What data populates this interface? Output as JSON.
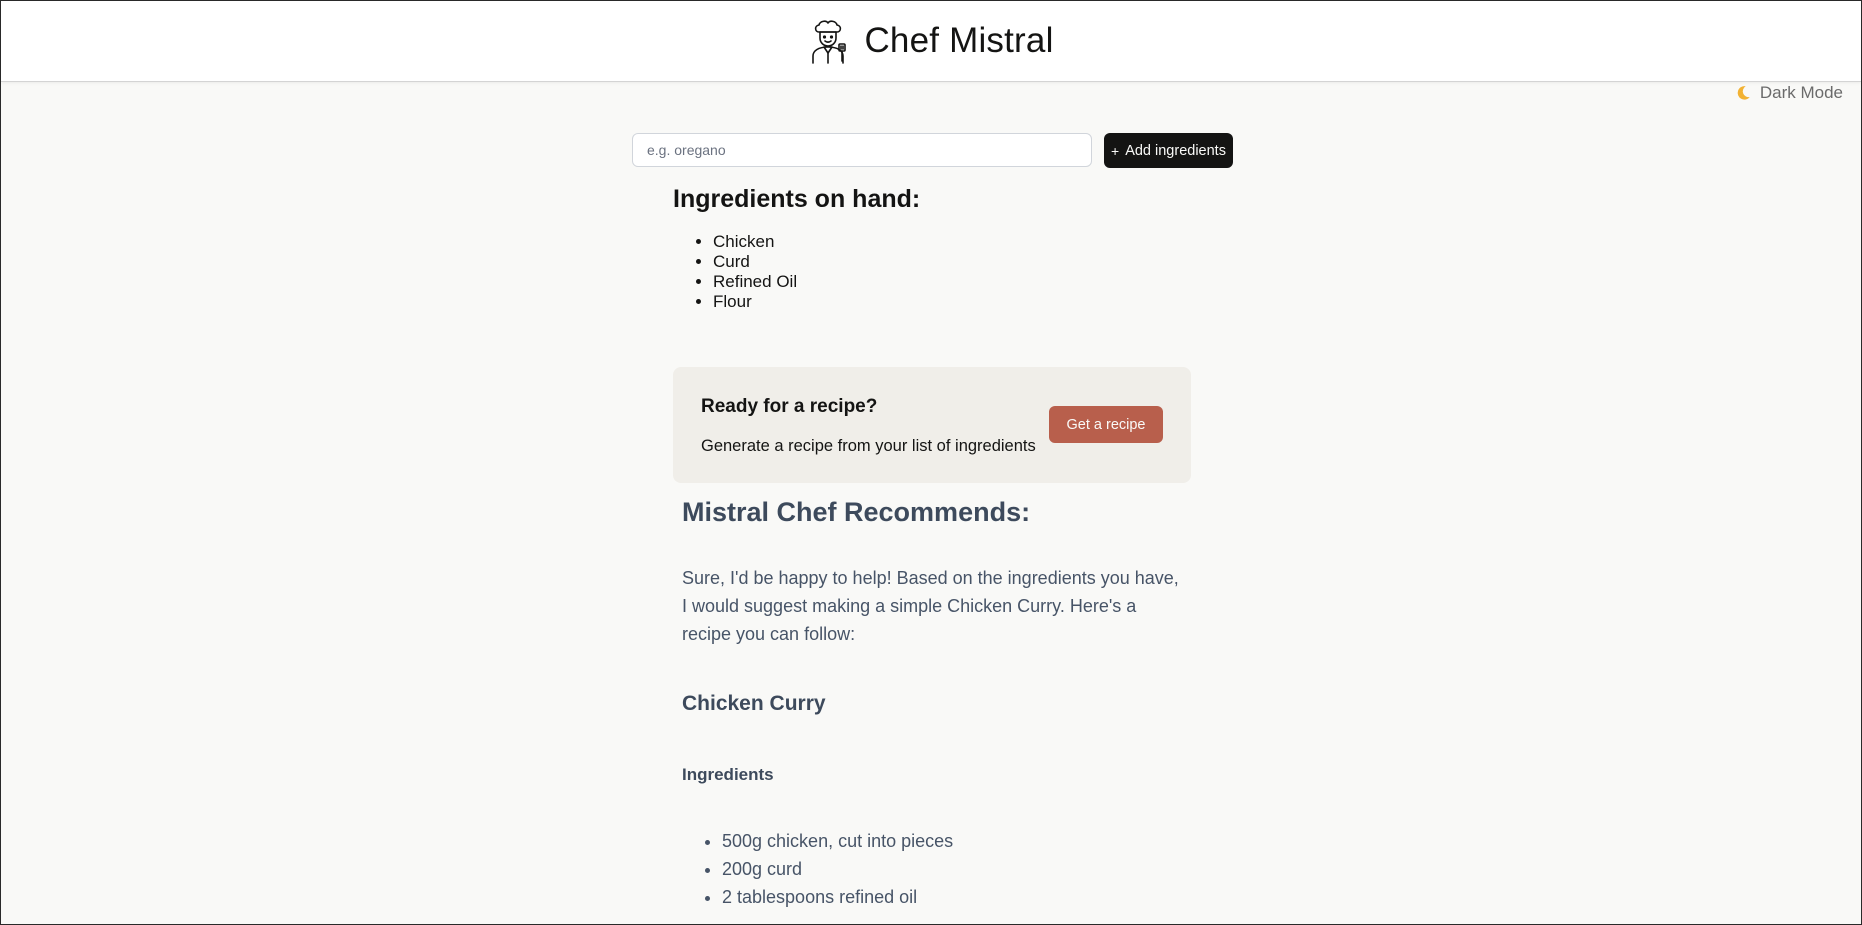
{
  "header": {
    "logo_icon": "chef-icon",
    "title": "Chef Mistral"
  },
  "dark_mode": {
    "icon": "moon-icon",
    "label": "Dark Mode"
  },
  "add_form": {
    "placeholder": "e.g. oregano",
    "value": "",
    "button_icon": "+",
    "button_label": "Add ingredients"
  },
  "on_hand": {
    "heading": "Ingredients on hand:",
    "items": [
      "Chicken",
      "Curd",
      "Refined Oil",
      "Flour"
    ]
  },
  "cta": {
    "title": "Ready for a recipe?",
    "subtitle": "Generate a recipe from your list of ingredients",
    "button_label": "Get a recipe"
  },
  "recipe": {
    "heading": "Mistral Chef Recommends:",
    "intro": "Sure, I'd be happy to help! Based on the ingredients you have, I would suggest making a simple Chicken Curry. Here's a recipe you can follow:",
    "dish_title": "Chicken Curry",
    "ingredients_heading": "Ingredients",
    "ingredients": [
      "500g chicken, cut into pieces",
      "200g curd",
      "2 tablespoons refined oil"
    ]
  },
  "colors": {
    "page_bg": "#f9f9f7",
    "primary_dark": "#141413",
    "accent": "#b85f4c",
    "card_bg": "#f0eee9",
    "recipe_text": "#475467"
  }
}
